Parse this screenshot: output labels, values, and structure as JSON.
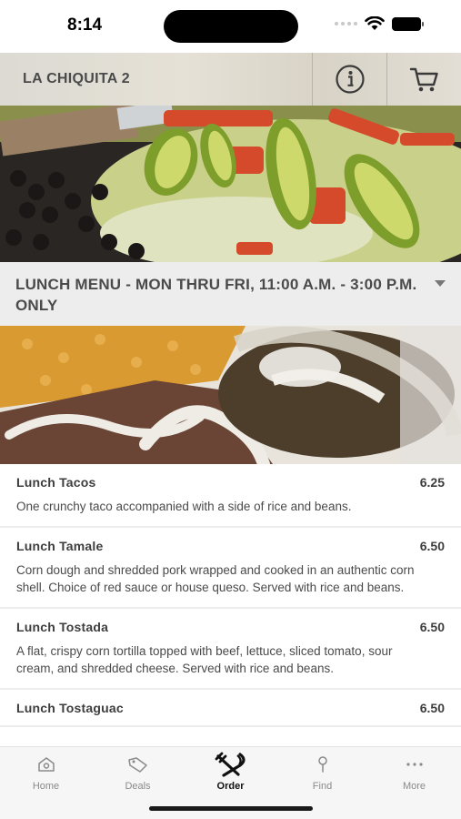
{
  "status_bar": {
    "time": "8:14"
  },
  "header": {
    "title": "LA CHIQUITA 2"
  },
  "category": {
    "title": "LUNCH MENU - MON THRU FRI, 11:00 A.M. - 3:00 P.M. ONLY"
  },
  "items": [
    {
      "name": "Lunch Tacos",
      "price": "6.25",
      "description": "One crunchy taco accompanied with a side of rice and beans."
    },
    {
      "name": "Lunch Tamale",
      "price": "6.50",
      "description": "Corn dough and shredded pork wrapped and cooked in an authentic corn shell. Choice of red sauce or house queso. Served with rice and beans."
    },
    {
      "name": "Lunch Tostada",
      "price": "6.50",
      "description": "A flat, crispy corn tortilla topped with beef, lettuce, sliced tomato, sour cream, and shredded cheese. Served with rice and beans."
    },
    {
      "name": "Lunch Tostaguac",
      "price": "6.50",
      "description": ""
    }
  ],
  "tabs": [
    {
      "label": "Home",
      "icon": "home-icon"
    },
    {
      "label": "Deals",
      "icon": "tag-icon"
    },
    {
      "label": "Order",
      "icon": "utensils-icon",
      "active": true
    },
    {
      "label": "Find",
      "icon": "pin-icon"
    },
    {
      "label": "More",
      "icon": "more-icon"
    }
  ],
  "colors": {
    "category_bg": "#ededed",
    "tab_bg": "#f6f6f6",
    "text": "#4a4a4a"
  }
}
